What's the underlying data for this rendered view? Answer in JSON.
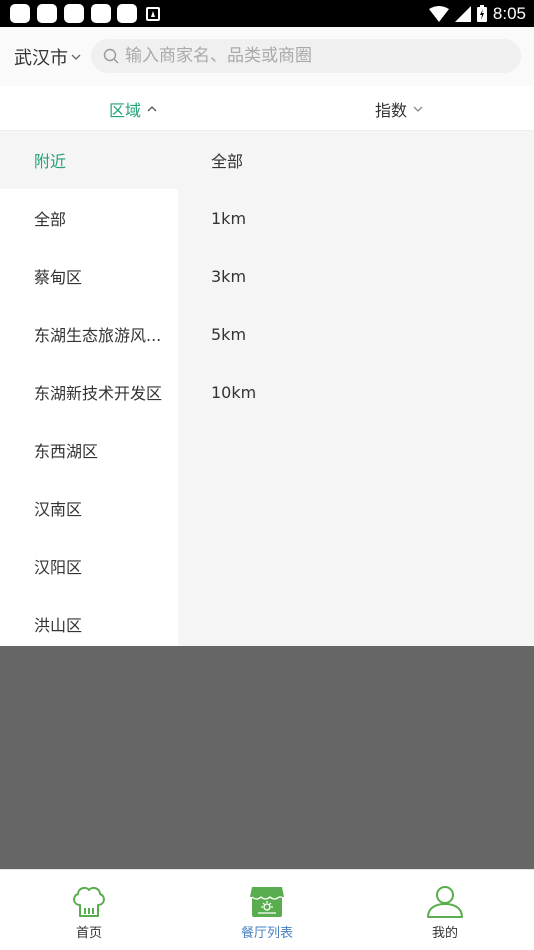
{
  "status_bar": {
    "time": "8:05"
  },
  "header": {
    "city": "武汉市",
    "search_placeholder": "输入商家名、品类或商圈"
  },
  "filters": {
    "tabs": [
      {
        "label": "区域",
        "active": true
      },
      {
        "label": "指数",
        "active": false
      }
    ]
  },
  "region_panel": {
    "districts": [
      "附近",
      "全部",
      "蔡甸区",
      "东湖生态旅游风...",
      "东湖新技术开发区",
      "东西湖区",
      "汉南区",
      "汉阳区",
      "洪山区"
    ],
    "selected_district": "附近",
    "distances": [
      "全部",
      "1km",
      "3km",
      "5km",
      "10km"
    ]
  },
  "bottom_nav": {
    "items": [
      {
        "label": "首页",
        "icon": "chef-hat-icon",
        "active": false
      },
      {
        "label": "餐厅列表",
        "icon": "restaurant-icon",
        "active": true
      },
      {
        "label": "我的",
        "icon": "user-icon",
        "active": false
      }
    ]
  },
  "colors": {
    "accent": "#20a37a",
    "nav_active": "#4a80c2",
    "mask": "#666666"
  }
}
